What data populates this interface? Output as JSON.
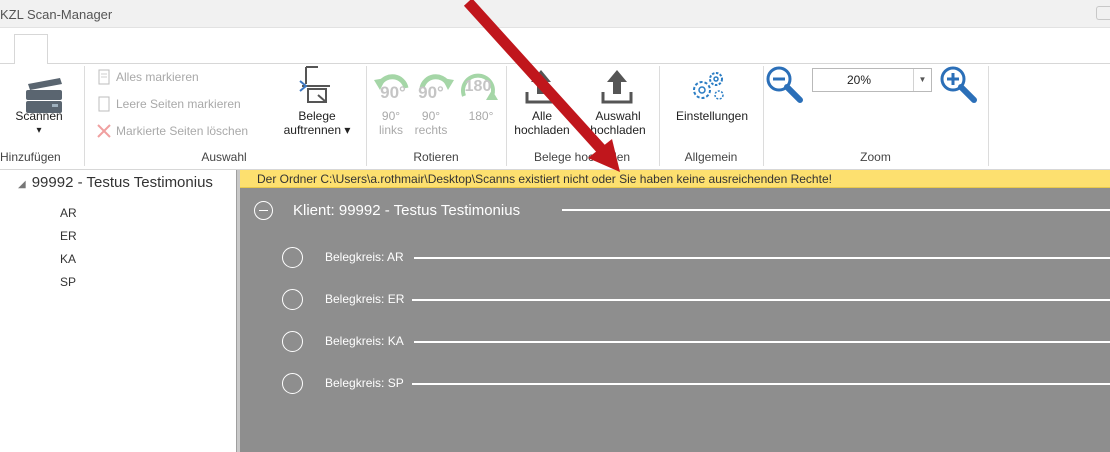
{
  "window": {
    "title": "KZL Scan-Manager"
  },
  "ribbon": {
    "scannen": {
      "label": "Scannen",
      "dropdown": "▾"
    },
    "hinzufuegen_group": "Hinzufügen",
    "auswahl_group": "Auswahl",
    "alles_markieren": "Alles markieren",
    "leere_seiten": "Leere Seiten markieren",
    "markierte_loeschen": "Markierte Seiten löschen",
    "belege_auftrennen": {
      "line1": "Belege",
      "line2": "auftrennen ▾"
    },
    "rotieren_group": "Rotieren",
    "rot_links": {
      "deg": "90°",
      "line1": "90°",
      "line2": "links"
    },
    "rot_rechts": {
      "deg": "90°",
      "line1": "90°",
      "line2": "rechts"
    },
    "rot_180": {
      "deg": "180",
      "line1": "180°"
    },
    "belege_hochladen_group": "Belege hochladen",
    "alle_hochladen": {
      "line1": "Alle",
      "line2": "hochladen"
    },
    "auswahl_hochladen": {
      "line1": "Auswahl",
      "line2": "hochladen"
    },
    "allgemein_group": "Allgemein",
    "einstellungen": "Einstellungen",
    "zoom_group": "Zoom",
    "zoom_value": "20%"
  },
  "tree": {
    "root": "99992 - Testus Testimonius",
    "children": [
      "AR",
      "ER",
      "KA",
      "SP"
    ]
  },
  "warning": "Der Ordner C:\\Users\\a.rothmair\\Desktop\\Scanns existiert nicht oder Sie haben keine ausreichenden Rechte!",
  "content": {
    "klient": "Klient: 99992 - Testus Testimonius",
    "belegkreise": [
      "Belegkreis: AR",
      "Belegkreis: ER",
      "Belegkreis: KA",
      "Belegkreis: SP"
    ]
  },
  "colors": {
    "warning_bg": "#fde06f",
    "content_bg": "#8e8e8e",
    "annotation_arrow": "#c0161c",
    "rotate_green": "#a5d6a7",
    "zoom_blue": "#1e7fcf"
  }
}
